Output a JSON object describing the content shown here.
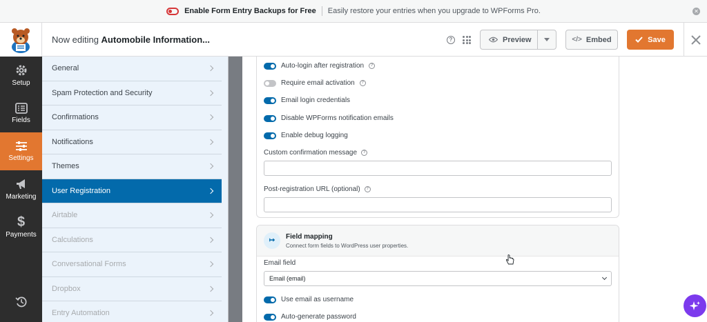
{
  "notice": {
    "title": "Enable Form Entry Backups for Free",
    "message": "Easily restore your entries when you upgrade to WPForms Pro.",
    "close_icon": "close-icon"
  },
  "header": {
    "editing_prefix": "Now editing ",
    "form_name": "Automobile Information...",
    "preview_label": "Preview",
    "embed_label": "Embed",
    "save_label": "Save",
    "accent": "#e27730"
  },
  "iconnav": {
    "items": [
      {
        "label": "Setup",
        "icon": "gear-icon"
      },
      {
        "label": "Fields",
        "icon": "fields-icon"
      },
      {
        "label": "Settings",
        "icon": "sliders-icon",
        "active": true
      },
      {
        "label": "Marketing",
        "icon": "megaphone-icon"
      },
      {
        "label": "Payments",
        "icon": "dollar-icon"
      }
    ],
    "history_icon": "history-icon"
  },
  "panel": {
    "items": [
      {
        "label": "General"
      },
      {
        "label": "Spam Protection and Security"
      },
      {
        "label": "Confirmations"
      },
      {
        "label": "Notifications"
      },
      {
        "label": "Themes"
      },
      {
        "label": "User Registration",
        "active": true
      },
      {
        "label": "Airtable",
        "disabled": true
      },
      {
        "label": "Calculations",
        "disabled": true
      },
      {
        "label": "Conversational Forms",
        "disabled": true
      },
      {
        "label": "Dropbox",
        "disabled": true
      },
      {
        "label": "Entry Automation",
        "disabled": true
      }
    ]
  },
  "settings": {
    "toggles": [
      {
        "label": "Auto-login after registration",
        "on": true,
        "help": true
      },
      {
        "label": "Require email activation",
        "on": false,
        "help": true
      },
      {
        "label": "Email login credentials",
        "on": true,
        "help": false
      },
      {
        "label": "Disable WPForms notification emails",
        "on": true,
        "help": false
      },
      {
        "label": "Enable debug logging",
        "on": true,
        "help": false
      }
    ],
    "custom_confirmation_label": "Custom confirmation message",
    "custom_confirmation_value": "",
    "post_registration_url_label": "Post-registration URL (optional)",
    "post_registration_url_value": ""
  },
  "field_mapping": {
    "title": "Field mapping",
    "description": "Connect form fields to WordPress user properties.",
    "email_field_label": "Email field",
    "email_field_value": "Email (email)",
    "toggles": [
      {
        "label": "Use email as username",
        "on": true
      },
      {
        "label": "Auto-generate password",
        "on": true
      }
    ]
  }
}
